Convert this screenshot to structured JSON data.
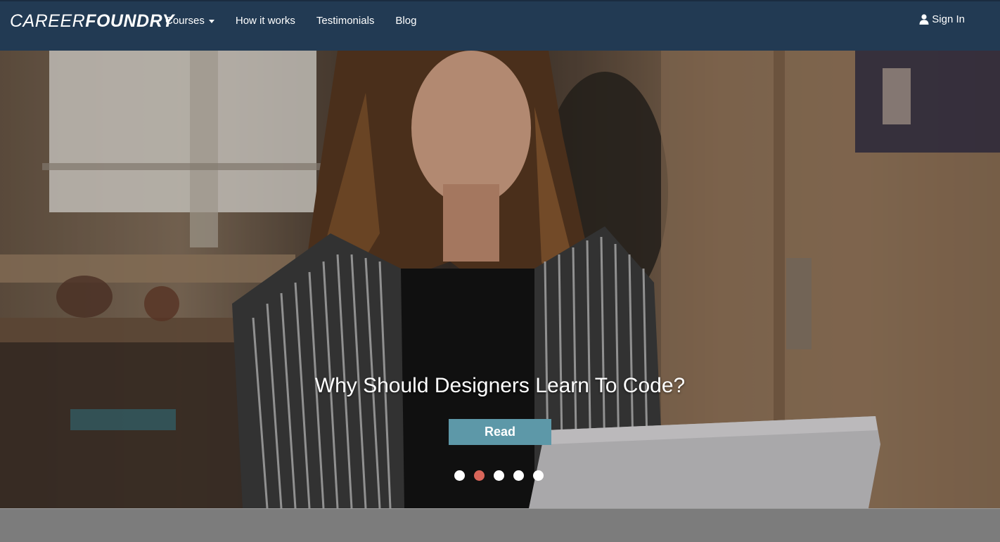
{
  "brand": {
    "logo_light": "CAREER",
    "logo_bold": "FOUNDRY"
  },
  "nav": {
    "items": [
      {
        "label": "Courses",
        "has_dropdown": true
      },
      {
        "label": "How it works"
      },
      {
        "label": "Testimonials"
      },
      {
        "label": "Blog"
      }
    ],
    "signin_label": "Sign In"
  },
  "hero": {
    "title": "Why Should Designers Learn To Code?",
    "button_label": "Read",
    "slides_total": 5,
    "active_slide": 2
  },
  "colors": {
    "navbar": "#223a53",
    "button": "#5d98a8",
    "active_dot": "#d9665a"
  }
}
